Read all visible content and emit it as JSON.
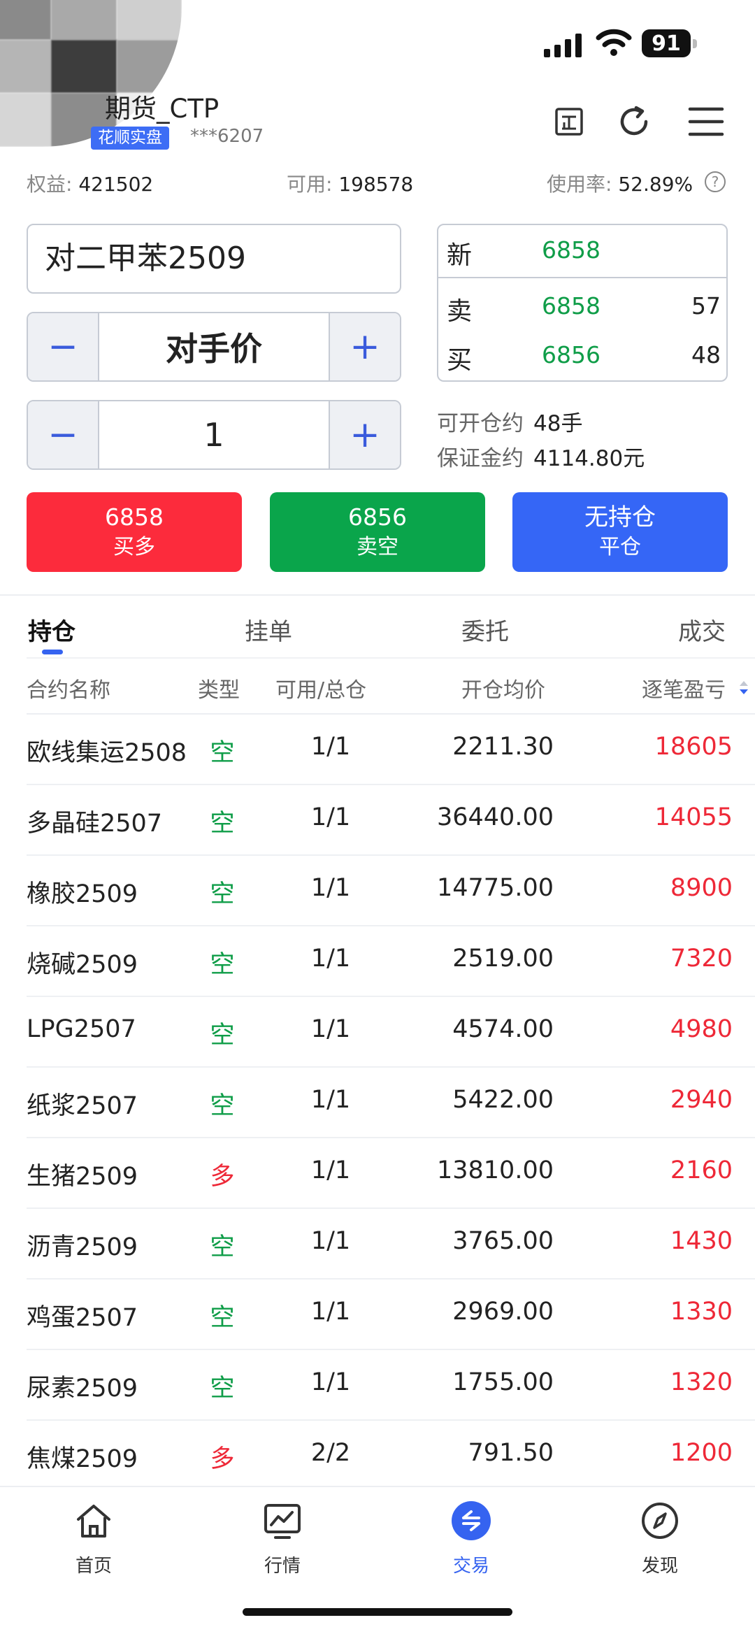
{
  "status_bar": {
    "battery": "91"
  },
  "header": {
    "account_title": "期货_CTP",
    "account_badge": "花顺实盘",
    "account_number": "***6207"
  },
  "summary": {
    "equity_label": "权益:",
    "equity_value": "421502",
    "available_label": "可用:",
    "available_value": "198578",
    "usage_label": "使用率:",
    "usage_value": "52.89%"
  },
  "order": {
    "contract": "对二甲苯2509",
    "price_type": "对手价",
    "quantity": "1",
    "minus": "−",
    "plus": "+"
  },
  "quote": {
    "latest_label": "新",
    "latest_price": "6858",
    "ask_label": "卖",
    "ask_price": "6858",
    "ask_volume": "57",
    "bid_label": "买",
    "bid_price": "6856",
    "bid_volume": "48"
  },
  "capacity": {
    "openable_label": "可开仓约",
    "openable_value": "48手",
    "margin_label": "保证金约",
    "margin_value": "4114.80元"
  },
  "buttons": {
    "buy_price": "6858",
    "buy_label": "买多",
    "sell_price": "6856",
    "sell_label": "卖空",
    "close_top": "无持仓",
    "close_label": "平仓"
  },
  "tabs": [
    "持仓",
    "挂单",
    "委托",
    "成交"
  ],
  "table": {
    "headers": [
      "合约名称",
      "类型",
      "可用/总仓",
      "开仓均价",
      "逐笔盈亏"
    ],
    "rows": [
      {
        "name": "欧线集运2508",
        "type": "空",
        "qty": "1/1",
        "price": "2211.30",
        "pnl": "18605"
      },
      {
        "name": "多晶硅2507",
        "type": "空",
        "qty": "1/1",
        "price": "36440.00",
        "pnl": "14055"
      },
      {
        "name": "橡胶2509",
        "type": "空",
        "qty": "1/1",
        "price": "14775.00",
        "pnl": "8900"
      },
      {
        "name": "烧碱2509",
        "type": "空",
        "qty": "1/1",
        "price": "2519.00",
        "pnl": "7320"
      },
      {
        "name": "LPG2507",
        "type": "空",
        "qty": "1/1",
        "price": "4574.00",
        "pnl": "4980"
      },
      {
        "name": "纸浆2507",
        "type": "空",
        "qty": "1/1",
        "price": "5422.00",
        "pnl": "2940"
      },
      {
        "name": "生猪2509",
        "type": "多",
        "qty": "1/1",
        "price": "13810.00",
        "pnl": "2160"
      },
      {
        "name": "沥青2509",
        "type": "空",
        "qty": "1/1",
        "price": "3765.00",
        "pnl": "1430"
      },
      {
        "name": "鸡蛋2507",
        "type": "空",
        "qty": "1/1",
        "price": "2969.00",
        "pnl": "1330"
      },
      {
        "name": "尿素2509",
        "type": "空",
        "qty": "1/1",
        "price": "1755.00",
        "pnl": "1320"
      },
      {
        "name": "焦煤2509",
        "type": "多",
        "qty": "2/2",
        "price": "791.50",
        "pnl": "1200"
      }
    ]
  },
  "nav": [
    {
      "label": "首页",
      "icon": "home-icon"
    },
    {
      "label": "行情",
      "icon": "chart-icon"
    },
    {
      "label": "交易",
      "icon": "trade-icon"
    },
    {
      "label": "发现",
      "icon": "compass-icon"
    }
  ],
  "colors": {
    "accent": "#3563f0",
    "up": "#ee2837",
    "down": "#0f9d48",
    "buy": "#fc2b3c",
    "sell": "#0aa54b",
    "close": "#3566f6"
  }
}
